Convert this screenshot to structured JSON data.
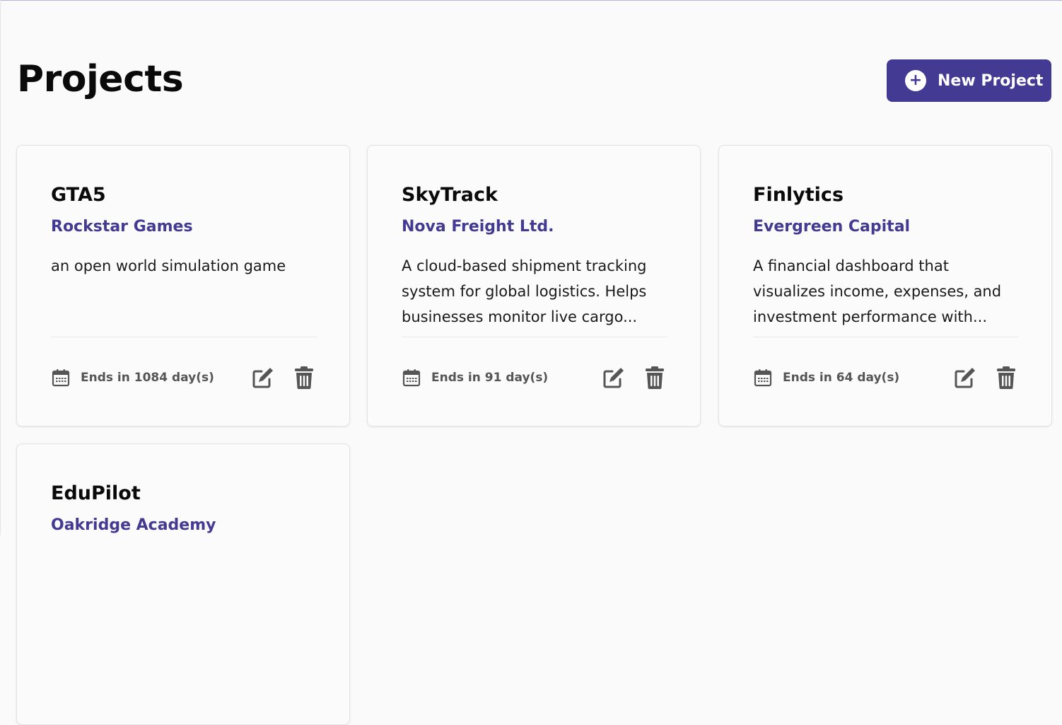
{
  "header": {
    "title": "Projects",
    "new_button_label": "New Project"
  },
  "colors": {
    "accent": "#433a93",
    "muted_text": "#555555"
  },
  "projects": [
    {
      "name": "GTA5",
      "client": "Rockstar Games",
      "description": "an open world simulation game",
      "due": "Ends in 1084 day(s)"
    },
    {
      "name": "SkyTrack",
      "client": "Nova Freight Ltd.",
      "description": "A cloud-based shipment tracking system for global logistics. Helps businesses monitor live cargo...",
      "due": "Ends in 91 day(s)"
    },
    {
      "name": "Finlytics",
      "client": "Evergreen Capital",
      "description": "A financial dashboard that visualizes income, expenses, and investment performance with...",
      "due": "Ends in 64 day(s)"
    },
    {
      "name": "EduPilot",
      "client": "Oakridge Academy",
      "description": "",
      "due": ""
    }
  ],
  "icons": {
    "calendar": "calendar-icon",
    "edit": "edit-icon",
    "delete": "trash-icon",
    "add": "plus-circle-icon"
  }
}
